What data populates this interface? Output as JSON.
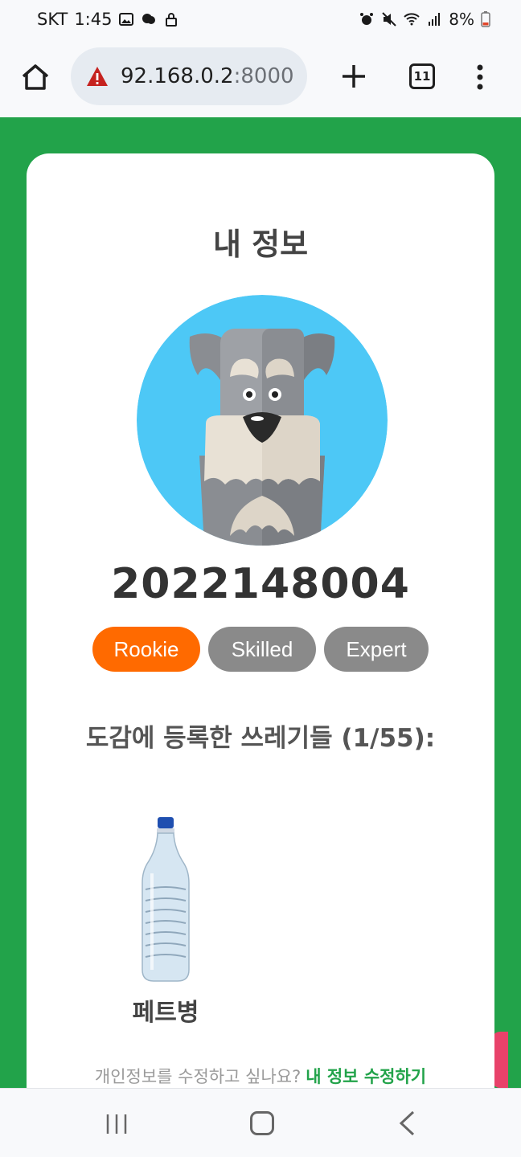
{
  "status_bar": {
    "carrier": "SKT",
    "time": "1:45",
    "battery": "8%"
  },
  "browser": {
    "url_host": "92.168.0.2",
    "url_port": ":8000",
    "tab_count": "11"
  },
  "page": {
    "title": "내 정보",
    "user_id": "2022148004",
    "levels": [
      {
        "label": "Rookie",
        "active": true,
        "color": "#ff6a00"
      },
      {
        "label": "Skilled",
        "active": false,
        "color": "#8a8a8a"
      },
      {
        "label": "Expert",
        "active": false,
        "color": "#8a8a8a"
      }
    ],
    "collection_title": "도감에 등록한 쓰레기들 (1/55):",
    "items": [
      {
        "name": "페트병",
        "icon": "water-bottle-icon"
      }
    ],
    "edit_prompt": "개인정보를 수정하고 싶나요?",
    "edit_link": "내 정보 수정하기"
  },
  "colors": {
    "page_background": "#22a34a",
    "card": "#ffffff",
    "active_level": "#ff6a00",
    "inactive_level": "#8a8a8a",
    "link": "#22a34a"
  }
}
